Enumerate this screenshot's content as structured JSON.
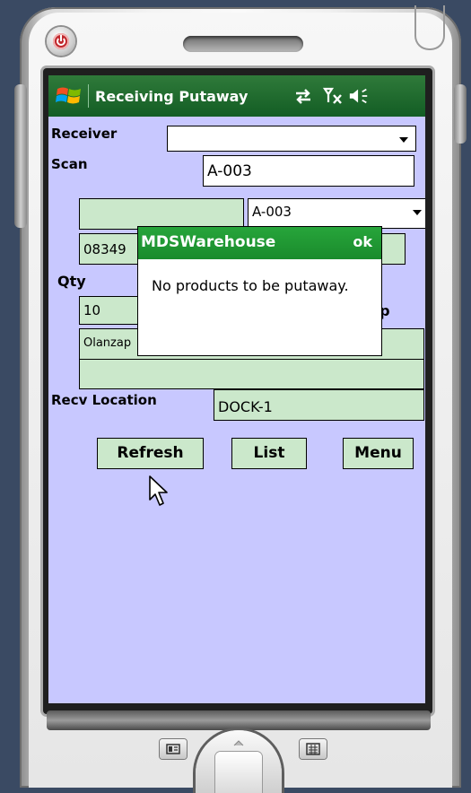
{
  "window": {
    "title": "Receiving Putaway"
  },
  "form": {
    "receiver_label": "Receiver",
    "receiver_value": "",
    "scan_label": "Scan",
    "scan_value": "A-003",
    "location_select_value": "A-003",
    "product_code_partial": "08349",
    "qty_label": "Qty",
    "qty_value": "10",
    "description_label_partial": "tip",
    "description_partial": "Olanzap",
    "recv_location_label": "Recv Location",
    "recv_location_value": "DOCK-1"
  },
  "buttons": {
    "refresh": "Refresh",
    "list": "List",
    "menu": "Menu"
  },
  "dialog": {
    "title": "MDSWarehouse",
    "ok_label": "ok",
    "message": "No products to be putaway."
  },
  "colors": {
    "screen_bg": "#c8c8ff",
    "titlebar": "#135d24",
    "field_green": "#cbe8cb",
    "dialog_title": "#1a8b2c"
  },
  "icons": {
    "start": "windows-flag-icon",
    "connectivity": "sync-arrows-icon",
    "signal": "no-signal-icon",
    "volume": "speaker-icon"
  }
}
